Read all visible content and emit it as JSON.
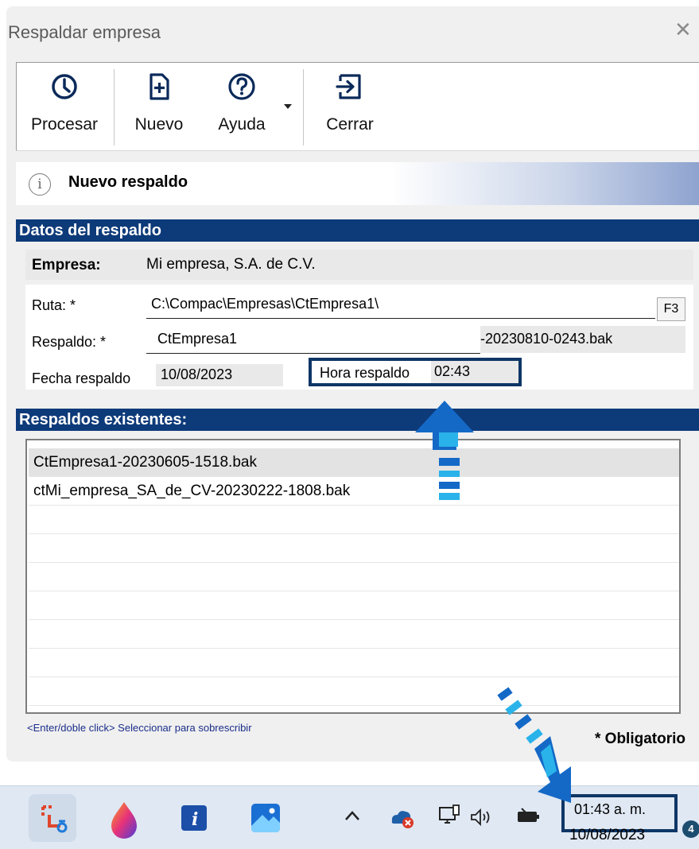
{
  "window": {
    "title": "Respaldar empresa",
    "close_glyph": "✕"
  },
  "toolbar": {
    "procesar": {
      "label": "Procesar",
      "icon": "clock-icon"
    },
    "nuevo": {
      "label": "Nuevo",
      "icon": "new-document-icon"
    },
    "ayuda": {
      "label": "Ayuda",
      "icon": "help-icon"
    },
    "cerrar": {
      "label": "Cerrar",
      "icon": "exit-icon"
    }
  },
  "info": {
    "text": "Nuevo respaldo",
    "icon_glyph": "i"
  },
  "datos": {
    "header": "Datos del respaldo",
    "empresa_label": "Empresa:",
    "empresa_value": "Mi empresa, S.A. de C.V.",
    "ruta_label": "Ruta: *",
    "ruta_value": "C:\\Compac\\Empresas\\CtEmpresa1\\",
    "ruta_button": "F3",
    "respaldo_label": "Respaldo: *",
    "respaldo_value": "CtEmpresa1",
    "respaldo_suffix": "-20230810-0243.bak",
    "fecha_label": "Fecha respaldo",
    "fecha_value": "10/08/2023",
    "hora_label": "Hora respaldo",
    "hora_value": "02:43"
  },
  "existentes": {
    "header": "Respaldos existentes:",
    "items": [
      "CtEmpresa1-20230605-1518.bak",
      "ctMi_empresa_SA_de_CV-20230222-1808.bak"
    ]
  },
  "footer": {
    "hint": "<Enter/doble click> Seleccionar para sobrescribir",
    "obligatorio": "* Obligatorio"
  },
  "taskbar": {
    "clock_time": "01:43 a. m.",
    "clock_date": "10/08/2023",
    "notification_count": "4",
    "apps": [
      "snipping-tool-icon",
      "paint-drop-icon",
      "info-app-icon",
      "photos-icon"
    ],
    "tray": [
      "chevron-up-icon",
      "onedrive-error-icon",
      "network-icon",
      "volume-icon",
      "battery-icon"
    ]
  },
  "colors": {
    "section_header": "#0d3a79",
    "highlight_border": "#0e3666",
    "arrow_blue": "#1469c7",
    "arrow_cyan": "#2ab3ea"
  }
}
